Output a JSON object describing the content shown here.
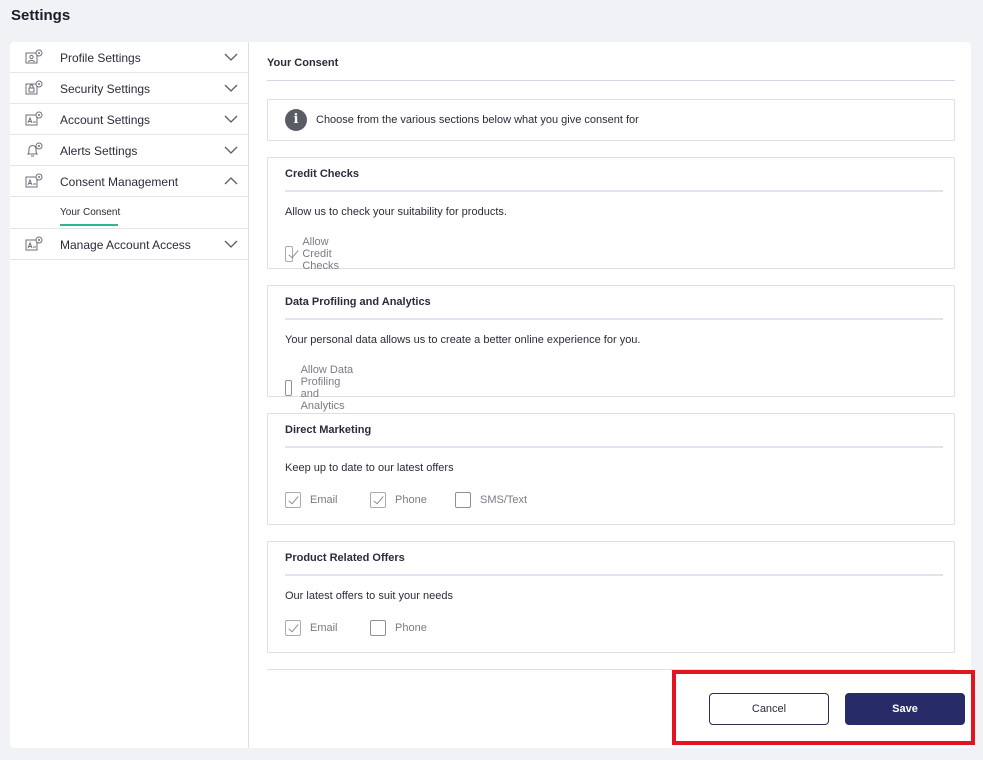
{
  "page": {
    "title": "Settings"
  },
  "sidebar": {
    "items": [
      {
        "label": "Profile Settings",
        "icon": "profile-settings-icon",
        "expanded": false
      },
      {
        "label": "Security Settings",
        "icon": "security-settings-icon",
        "expanded": false
      },
      {
        "label": "Account Settings",
        "icon": "account-settings-icon",
        "expanded": false
      },
      {
        "label": "Alerts Settings",
        "icon": "bell-settings-icon",
        "expanded": false
      },
      {
        "label": "Consent Management",
        "icon": "consent-settings-icon",
        "expanded": true,
        "children": [
          {
            "label": "Your Consent",
            "active": true
          }
        ]
      },
      {
        "label": "Manage Account Access",
        "icon": "access-settings-icon",
        "expanded": false
      }
    ]
  },
  "main": {
    "title": "Your Consent",
    "info": "Choose from the various sections below what you give consent for",
    "sections": [
      {
        "title": "Credit Checks",
        "description": "Allow us to check your suitability for products.",
        "options": [
          {
            "label": "Allow Credit Checks",
            "checked": true
          }
        ]
      },
      {
        "title": "Data Profiling and Analytics",
        "description": "Your personal data allows us to create a better online experience for you.",
        "options": [
          {
            "label": "Allow Data Profiling and Analytics",
            "checked": false
          }
        ]
      },
      {
        "title": "Direct Marketing",
        "description": "Keep up to date to our latest offers",
        "options": [
          {
            "label": "Email",
            "checked": true
          },
          {
            "label": "Phone",
            "checked": true
          },
          {
            "label": "SMS/Text",
            "checked": false
          }
        ]
      },
      {
        "title": "Product Related Offers",
        "description": "Our latest offers to suit your needs",
        "options": [
          {
            "label": "Email",
            "checked": true
          },
          {
            "label": "Phone",
            "checked": false
          }
        ]
      }
    ],
    "buttons": {
      "cancel": "Cancel",
      "save": "Save"
    }
  },
  "colors": {
    "accent": "#272b67",
    "active_underline": "#2fb88f",
    "highlight": "#e3141e"
  }
}
